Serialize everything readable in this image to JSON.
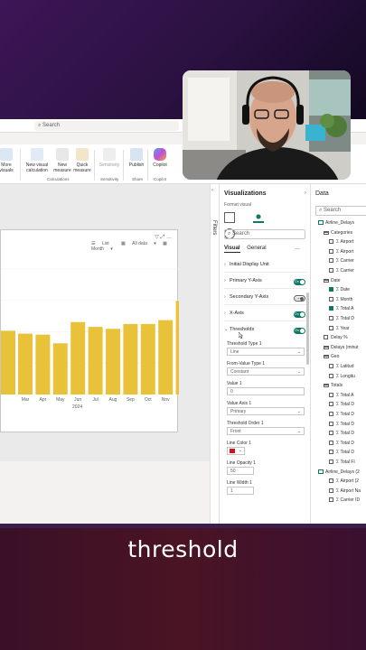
{
  "caption": "threshold",
  "window": {
    "search_placeholder": "Search"
  },
  "ribbon": {
    "buttons": [
      {
        "label": "More visuals"
      },
      {
        "label": "New visual calculation"
      },
      {
        "label": "New measure"
      },
      {
        "label": "Quick measure"
      },
      {
        "label": "Sensitivity"
      },
      {
        "label": "Publish"
      },
      {
        "label": "Copilot"
      }
    ],
    "groups": [
      "Calculations",
      "Sensitivity",
      "Share",
      "Copilot"
    ]
  },
  "visual": {
    "filter_list": "List",
    "filter_all_data": "All data",
    "filter_month": "Month",
    "year_label": "2024"
  },
  "chart_data": {
    "type": "bar",
    "categories": [
      "Mar",
      "Apr",
      "May",
      "Jun",
      "Jul",
      "Aug",
      "Sep",
      "Oct",
      "Nov",
      "Dec"
    ],
    "values": [
      63,
      62,
      53,
      75,
      70,
      68,
      73,
      73,
      77,
      97
    ],
    "partial_first_value": 66,
    "color": "#e8c33a",
    "x_title": "2024"
  },
  "filters_label": "Filters",
  "visualizations": {
    "title": "Visualizations",
    "subtitle": "Format visual",
    "search_placeholder": "Search",
    "tabs": [
      "Visual",
      "General"
    ],
    "sections": [
      {
        "label": "Initial Display Unit",
        "toggle": null
      },
      {
        "label": "Primary Y-Axis",
        "toggle": "On"
      },
      {
        "label": "Secondary Y-Axis",
        "toggle": "Off"
      },
      {
        "label": "X-Axis",
        "toggle": "On"
      },
      {
        "label": "Thresholds",
        "toggle": "On"
      }
    ],
    "fields": [
      {
        "label": "Threshold Type 1",
        "value": "Line"
      },
      {
        "label": "From-Value Type 1",
        "value": "Constant"
      },
      {
        "label": "Value 1",
        "value": "0"
      },
      {
        "label": "Value Axis 1",
        "value": "Primary"
      },
      {
        "label": "Threshold Order 1",
        "value": "Front"
      },
      {
        "label": "Line Color 1",
        "value": ""
      },
      {
        "label": "Line Opacity 1",
        "value": "50"
      },
      {
        "label": "Line Width 1",
        "value": "1"
      }
    ],
    "line_color": "#d0121f"
  },
  "data_pane": {
    "title": "Data",
    "search_placeholder": "Search",
    "items": [
      {
        "text": "Airline_Delays",
        "type": "table",
        "indent": 0
      },
      {
        "text": "Categories",
        "type": "folder",
        "indent": 1
      },
      {
        "text": "Airport",
        "type": "cb",
        "indent": 2
      },
      {
        "text": "Airport",
        "type": "cb",
        "indent": 2
      },
      {
        "text": "Carrier",
        "type": "cb",
        "indent": 2
      },
      {
        "text": "Carrier",
        "type": "cb",
        "indent": 2
      },
      {
        "text": "Date",
        "type": "folder",
        "indent": 1
      },
      {
        "text": "Date",
        "type": "cbon",
        "indent": 2
      },
      {
        "text": "Month",
        "type": "sigma",
        "indent": 2
      },
      {
        "text": "Total A",
        "type": "cbon",
        "indent": 2
      },
      {
        "text": "Total D",
        "type": "cb",
        "indent": 2
      },
      {
        "text": "Year",
        "type": "sigma",
        "indent": 2
      },
      {
        "text": "Delay %",
        "type": "cb",
        "indent": 1
      },
      {
        "text": "Delays (minut",
        "type": "folder",
        "indent": 1
      },
      {
        "text": "Geo",
        "type": "folder",
        "indent": 1
      },
      {
        "text": "Latitud",
        "type": "cb",
        "indent": 2
      },
      {
        "text": "Longitu",
        "type": "cb",
        "indent": 2
      },
      {
        "text": "Totals",
        "type": "folder",
        "indent": 1
      },
      {
        "text": "Total A",
        "type": "cb",
        "indent": 2
      },
      {
        "text": "Total D",
        "type": "cb",
        "indent": 2
      },
      {
        "text": "Total D",
        "type": "cb",
        "indent": 2
      },
      {
        "text": "Total D",
        "type": "cb",
        "indent": 2
      },
      {
        "text": "Total D",
        "type": "cb",
        "indent": 2
      },
      {
        "text": "Total D",
        "type": "cb",
        "indent": 2
      },
      {
        "text": "Total D",
        "type": "cb",
        "indent": 2
      },
      {
        "text": "Total Fl",
        "type": "cb",
        "indent": 2
      },
      {
        "text": "Airline_Delays (2",
        "type": "table",
        "indent": 0
      },
      {
        "text": "Airport (2",
        "type": "cb",
        "indent": 2
      },
      {
        "text": "Airport Na",
        "type": "cb",
        "indent": 2
      },
      {
        "text": "Carrier ID",
        "type": "cb",
        "indent": 2
      }
    ]
  }
}
